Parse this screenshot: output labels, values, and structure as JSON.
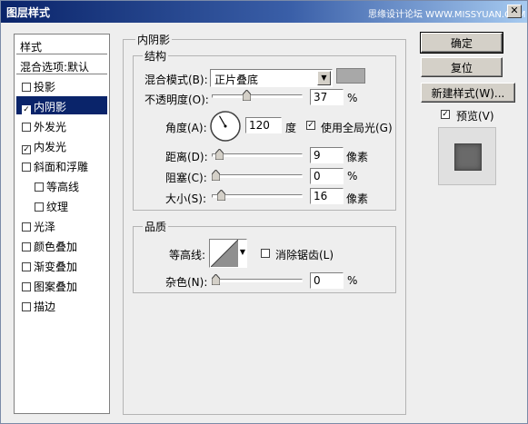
{
  "window": {
    "title": "图层样式",
    "watermark": "思缘设计论坛 WWW.MISSYUAN.COM"
  },
  "sidebar": {
    "header": "样式",
    "blend_default": "混合选项:默认",
    "items": [
      {
        "label": "投影",
        "checked": false,
        "selected": false,
        "sub": false
      },
      {
        "label": "内阴影",
        "checked": true,
        "selected": true,
        "sub": false
      },
      {
        "label": "外发光",
        "checked": false,
        "selected": false,
        "sub": false
      },
      {
        "label": "内发光",
        "checked": true,
        "selected": false,
        "sub": false
      },
      {
        "label": "斜面和浮雕",
        "checked": false,
        "selected": false,
        "sub": false
      },
      {
        "label": "等高线",
        "checked": false,
        "selected": false,
        "sub": true
      },
      {
        "label": "纹理",
        "checked": false,
        "selected": false,
        "sub": true
      },
      {
        "label": "光泽",
        "checked": false,
        "selected": false,
        "sub": false
      },
      {
        "label": "颜色叠加",
        "checked": false,
        "selected": false,
        "sub": false
      },
      {
        "label": "渐变叠加",
        "checked": false,
        "selected": false,
        "sub": false
      },
      {
        "label": "图案叠加",
        "checked": false,
        "selected": false,
        "sub": false
      },
      {
        "label": "描边",
        "checked": false,
        "selected": false,
        "sub": false
      }
    ]
  },
  "panel": {
    "title": "内阴影",
    "structure": {
      "title": "结构",
      "blend_mode_label": "混合模式(B):",
      "blend_mode_value": "正片叠底",
      "color_swatch": "#a8a8a8",
      "opacity_label": "不透明度(O):",
      "opacity_value": "37",
      "opacity_unit": "%",
      "opacity_fraction": 0.37,
      "angle_label": "角度(A):",
      "angle_value": "120",
      "angle_unit": "度",
      "angle_degrees": 120,
      "global_light_label": "使用全局光(G)",
      "global_light_checked": true,
      "distance_label": "距离(D):",
      "distance_value": "9",
      "distance_unit": "像素",
      "distance_fraction": 0.04,
      "choke_label": "阻塞(C):",
      "choke_value": "0",
      "choke_unit": "%",
      "choke_fraction": 0,
      "size_label": "大小(S):",
      "size_value": "16",
      "size_unit": "像素",
      "size_fraction": 0.065
    },
    "quality": {
      "title": "品质",
      "contour_label": "等高线:",
      "antialias_label": "消除锯齿(L)",
      "antialias_checked": false,
      "noise_label": "杂色(N):",
      "noise_value": "0",
      "noise_unit": "%",
      "noise_fraction": 0
    }
  },
  "buttons": {
    "ok": "确定",
    "reset": "复位",
    "new_style": "新建样式(W)...",
    "preview_label": "预览(V)",
    "preview_checked": true
  }
}
